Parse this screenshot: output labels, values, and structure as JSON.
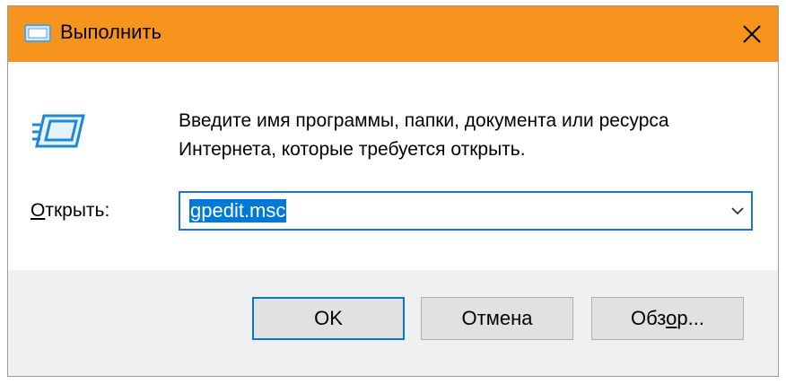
{
  "window": {
    "title": "Выполнить",
    "accent_color": "#f7941d",
    "icons": {
      "app": "run-dialog-icon",
      "close": "close-icon",
      "run": "run-program-icon",
      "dropdown": "chevron-down-icon"
    }
  },
  "dialog": {
    "description": "Введите имя программы, папки, документа или ресурса Интернета, которые требуется открыть.",
    "open_label": {
      "accel": "О",
      "rest": "ткрыть:"
    },
    "input": {
      "value": "gpedit.msc",
      "selection_color": "#0078d7"
    }
  },
  "buttons": {
    "ok": "OK",
    "cancel": "Отмена",
    "browse": {
      "before": "Обз",
      "accel": "о",
      "after": "р..."
    }
  }
}
